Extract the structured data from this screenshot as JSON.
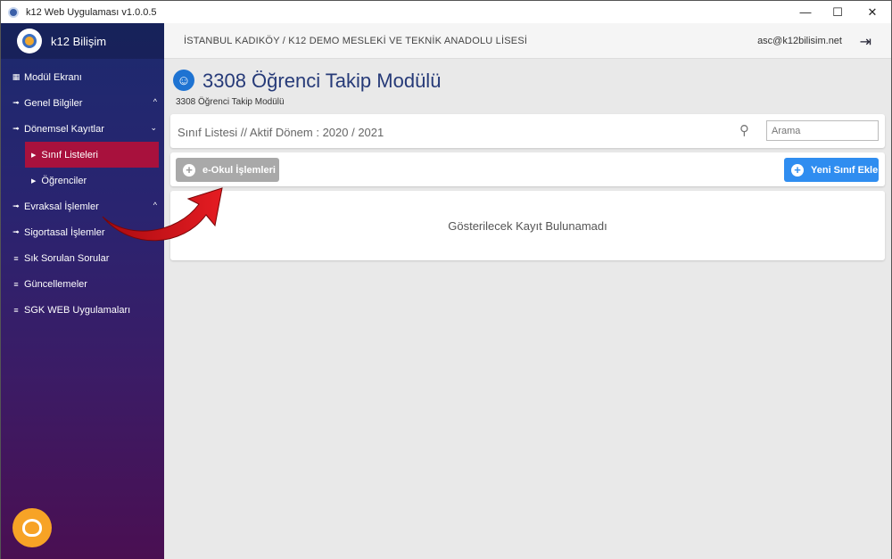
{
  "window": {
    "title": "k12 Web Uygulaması v1.0.0.5",
    "controls": {
      "minimize": "—",
      "maximize": "☐",
      "close": "✕"
    }
  },
  "sidebar": {
    "brand": "k12 Bilişim",
    "items": [
      {
        "label": "Modül Ekranı",
        "icon": "grid-icon"
      },
      {
        "label": "Genel Bilgiler",
        "icon": "truck-icon",
        "chevron": "^"
      },
      {
        "label": "Dönemsel Kayıtlar",
        "icon": "truck-icon",
        "chevron": "⌄"
      },
      {
        "label": "Sınıf Listeleri",
        "sub": true,
        "active": true
      },
      {
        "label": "Öğrenciler",
        "sub": true
      },
      {
        "label": "Evraksal İşlemler",
        "icon": "truck-icon",
        "chevron": "^"
      },
      {
        "label": "Sigortasal İşlemler",
        "icon": "truck-icon"
      },
      {
        "label": "Sık Sorulan Sorular",
        "icon": "list-icon"
      },
      {
        "label": "Güncellemeler",
        "icon": "list-icon"
      },
      {
        "label": "SGK WEB Uygulamaları",
        "icon": "list-icon"
      }
    ]
  },
  "topbar": {
    "school": "İSTANBUL KADIKÖY / K12 DEMO MESLEKİ VE TEKNİK ANADOLU LİSESİ",
    "user": "asc@k12bilisim.net"
  },
  "page": {
    "title": "3308 Öğrenci Takip Modülü",
    "subtitle": "3308 Öğrenci Takip Modülü"
  },
  "list": {
    "title": "Sınıf Listesi // Aktif Dönem : 2020 / 2021",
    "search_placeholder": "Arama"
  },
  "actions": {
    "eokul": "e-Okul İşlemleri",
    "new_class": "Yeni Sınıf Ekle"
  },
  "empty_message": "Gösterilecek Kayıt Bulunamadı",
  "colors": {
    "accent": "#2f8df0",
    "active_menu": "#a8113d",
    "arrow": "#d7161c",
    "support": "#f7a326"
  }
}
